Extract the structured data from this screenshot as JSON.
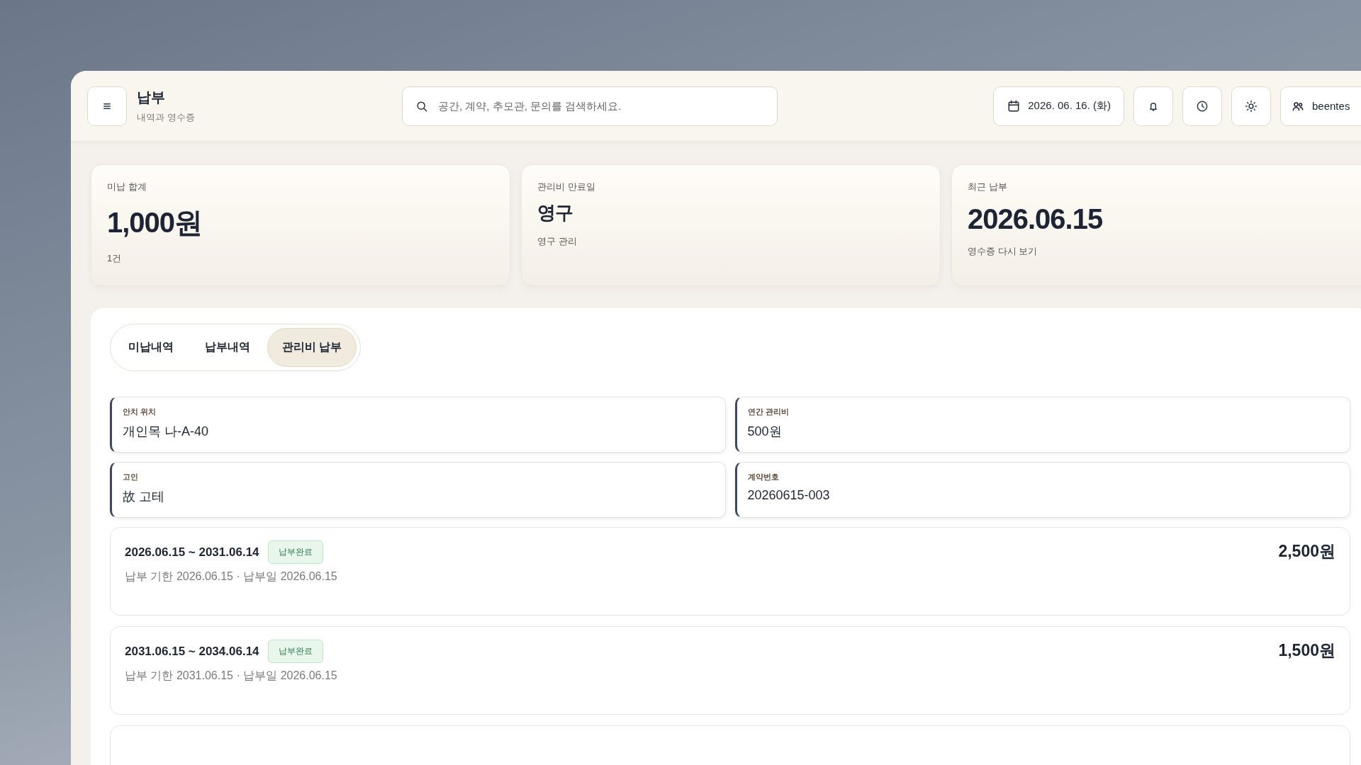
{
  "header": {
    "title": "납부",
    "subtitle": "내역과 영수증",
    "search": {
      "placeholder": "공간, 계약, 추모관, 문의를 검색하세요."
    },
    "date": "2026. 06. 16. (화)",
    "user": "beentes"
  },
  "stats": [
    {
      "label": "미납 합계",
      "value": "1,000원",
      "note": "1건",
      "kind": "large"
    },
    {
      "label": "관리비 만료일",
      "value": "영구",
      "note": "영구 관리",
      "kind": "small"
    },
    {
      "label": "최근 납부",
      "value": "2026.06.15",
      "note": "영수증 다시 보기",
      "kind": "large"
    }
  ],
  "tabs": [
    {
      "label": "미납내역",
      "selected": false
    },
    {
      "label": "납부내역",
      "selected": false
    },
    {
      "label": "관리비 납부",
      "selected": true
    }
  ],
  "fields": [
    {
      "label": "안치 위치",
      "value": "개인목 나-A-40"
    },
    {
      "label": "연간 관리비",
      "value": "500원"
    },
    {
      "label": "고인",
      "value": "故 고테"
    },
    {
      "label": "계약번호",
      "value": "20260615-003"
    }
  ],
  "payments": [
    {
      "period": "2026.06.15 ~ 2031.06.14",
      "status": "납부완료",
      "detail": "납부 기한 2026.06.15 · 납부일 2026.06.15",
      "amount": "2,500원"
    },
    {
      "period": "2031.06.15 ~ 2034.06.14",
      "status": "납부완료",
      "detail": "납부 기한 2031.06.15 · 납부일 2026.06.15",
      "amount": "1,500원"
    },
    {
      "kind": "cut"
    }
  ]
}
